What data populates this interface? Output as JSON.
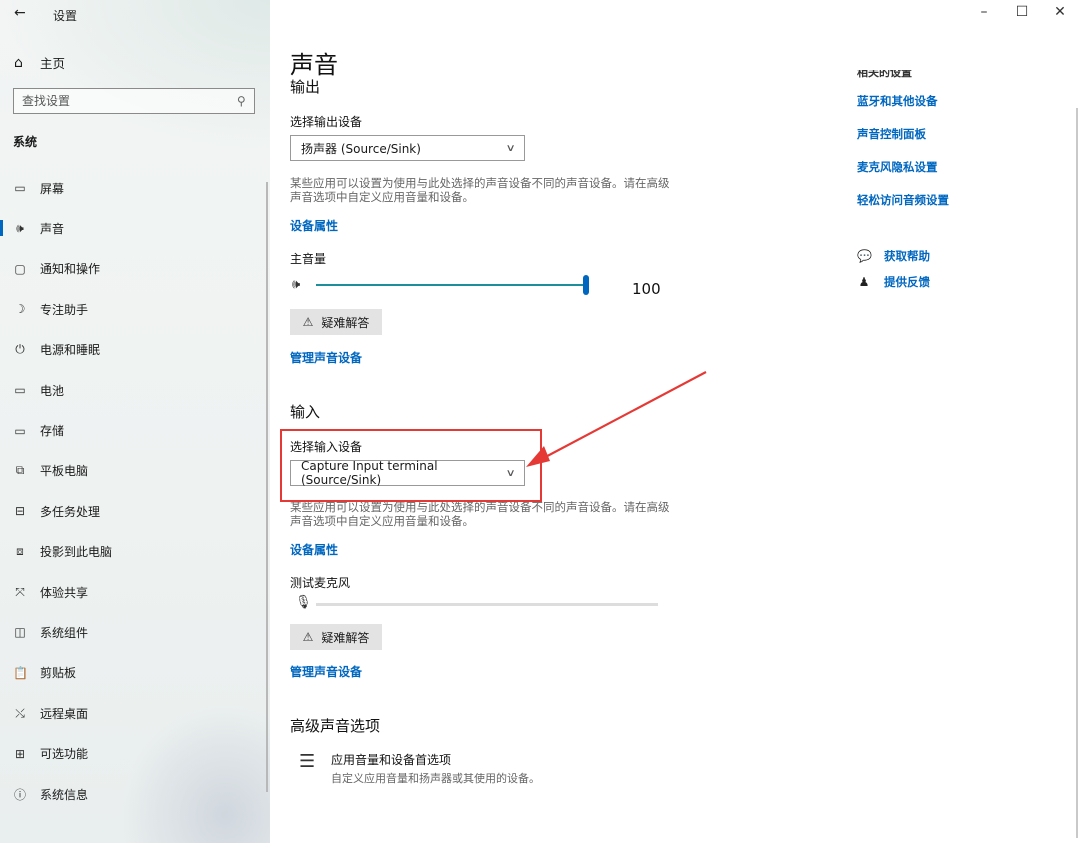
{
  "window": {
    "title": "设置",
    "back_icon": "←",
    "controls": {
      "minimize": "–",
      "maximize": "☐",
      "close": "✕"
    }
  },
  "sidebar": {
    "home_label": "主页",
    "search_placeholder": "查找设置",
    "section": "系统",
    "items": [
      {
        "label": "屏幕",
        "icon": "monitor-icon",
        "glyph": "▭"
      },
      {
        "label": "声音",
        "icon": "speaker-icon",
        "glyph": "🕪",
        "active": true
      },
      {
        "label": "通知和操作",
        "icon": "notification-icon",
        "glyph": "▢"
      },
      {
        "label": "专注助手",
        "icon": "moon-icon",
        "glyph": "☽"
      },
      {
        "label": "电源和睡眠",
        "icon": "power-icon",
        "glyph": "⏻"
      },
      {
        "label": "电池",
        "icon": "battery-icon",
        "glyph": "▭"
      },
      {
        "label": "存储",
        "icon": "storage-icon",
        "glyph": "▭"
      },
      {
        "label": "平板电脑",
        "icon": "tablet-icon",
        "glyph": "⧉"
      },
      {
        "label": "多任务处理",
        "icon": "multitask-icon",
        "glyph": "⊟"
      },
      {
        "label": "投影到此电脑",
        "icon": "project-icon",
        "glyph": "⧈"
      },
      {
        "label": "体验共享",
        "icon": "share-icon",
        "glyph": "⤧"
      },
      {
        "label": "系统组件",
        "icon": "components-icon",
        "glyph": "◫"
      },
      {
        "label": "剪贴板",
        "icon": "clipboard-icon",
        "glyph": "📋"
      },
      {
        "label": "远程桌面",
        "icon": "remote-icon",
        "glyph": "⤯"
      },
      {
        "label": "可选功能",
        "icon": "features-icon",
        "glyph": "⊞"
      },
      {
        "label": "系统信息",
        "icon": "info-icon",
        "glyph": "ⓘ"
      }
    ]
  },
  "main": {
    "title": "声音",
    "output": {
      "heading": "输出",
      "select_label": "选择输出设备",
      "device": "扬声器 (Source/Sink)",
      "desc": "某些应用可以设置为使用与此处选择的声音设备不同的声音设备。请在高级声音选项中自定义应用音量和设备。",
      "properties_link": "设备属性",
      "volume_label": "主音量",
      "volume": 100,
      "volume_text": "100",
      "troubleshoot": "疑难解答",
      "manage_link": "管理声音设备"
    },
    "input": {
      "heading": "输入",
      "select_label": "选择输入设备",
      "device": "Capture Input terminal (Source/Sink)",
      "desc": "某些应用可以设置为使用与此处选择的声音设备不同的声音设备。请在高级声音选项中自定义应用音量和设备。",
      "properties_link": "设备属性",
      "test_label": "测试麦克风",
      "troubleshoot": "疑难解答",
      "manage_link": "管理声音设备"
    },
    "advanced": {
      "heading": "高级声音选项",
      "item_title": "应用音量和设备首选项",
      "item_desc": "自定义应用音量和扬声器或其使用的设备。"
    }
  },
  "right": {
    "clipped_heading": "相关的设置",
    "links": [
      "蓝牙和其他设备",
      "声音控制面板",
      "麦克风隐私设置",
      "轻松访问音频设置"
    ],
    "help": "获取帮助",
    "feedback": "提供反馈"
  },
  "colors": {
    "accent": "#0067c0",
    "slider": "#1e8f9a",
    "annotation": "#e53935"
  }
}
